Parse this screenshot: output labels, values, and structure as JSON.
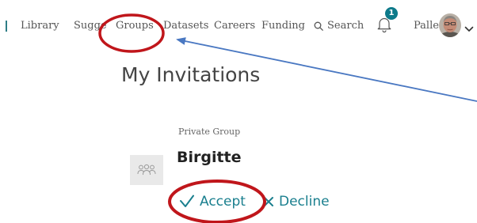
{
  "nav": {
    "items": [
      {
        "label": "Library"
      },
      {
        "label": "Suggestions"
      },
      {
        "label": "Groups"
      },
      {
        "label": "Datasets"
      },
      {
        "label": "Careers"
      },
      {
        "label": "Funding"
      }
    ],
    "search_label": "Search",
    "notification_count": "1",
    "user_name": "Palle"
  },
  "main": {
    "title": "My Invitations",
    "invitation": {
      "group_type": "Private Group",
      "group_name": "Birgitte",
      "accept_label": "Accept",
      "decline_label": "Decline"
    }
  },
  "colors": {
    "accent": "#1a7f8e",
    "badge": "#0d7a8a",
    "annotation_red": "#c0161b",
    "annotation_arrow": "#4a78c2"
  },
  "icons": {
    "search": "search-icon",
    "notification": "bell-icon",
    "account_menu": "chevron-down-icon",
    "group": "group-icon",
    "accept": "check-icon",
    "decline": "close-icon"
  }
}
